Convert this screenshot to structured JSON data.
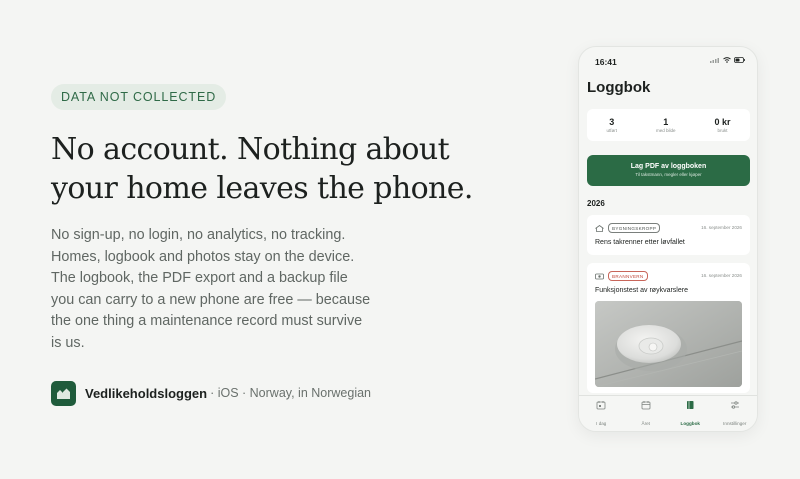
{
  "badge": "DATA NOT COLLECTED",
  "headline": {
    "line1": "No account. Nothing about",
    "line2": "your home leaves the phone."
  },
  "body": "No sign-up, no login, no analytics, no tracking. Homes, logbook and photos stay on the device. The logbook, the PDF export and a backup file you can carry to a new phone are free — because the one thing a maintenance record must survive is us.",
  "app": {
    "name": "Vedlikeholdsloggen",
    "meta": "· iOS · Norway, in Norwegian",
    "icon": "house-icon",
    "brand_color": "#1f5b3b"
  },
  "phone": {
    "time": "16:41",
    "title": "Loggbok",
    "stats": [
      {
        "value": "3",
        "label": "utført"
      },
      {
        "value": "1",
        "label": "med bilde"
      },
      {
        "value": "0 kr",
        "label": "brukt"
      }
    ],
    "pdf_button": {
      "title": "Lag PDF av loggboken",
      "subtitle": "Til takstmann, megler eller kjøper"
    },
    "year": "2026",
    "entries": [
      {
        "tag": "BYGNINGSKROPP",
        "date": "16. september 2026",
        "title": "Rens takrenner etter løvfallet",
        "icon": "house-outline-icon"
      },
      {
        "tag": "BRANNVERN",
        "date": "16. september 2026",
        "title": "Funksjonstest av røykvarslere",
        "icon": "smoke-alarm-icon"
      }
    ],
    "tabs": [
      {
        "label": "I dag",
        "icon": "calendar-today-icon"
      },
      {
        "label": "Året",
        "icon": "calendar-icon"
      },
      {
        "label": "Loggbok",
        "icon": "book-icon"
      },
      {
        "label": "Innstillinger",
        "icon": "sliders-icon"
      }
    ],
    "active_tab": "Loggbok",
    "accent": "#2b6b45",
    "tag_red": "#c0473a"
  }
}
